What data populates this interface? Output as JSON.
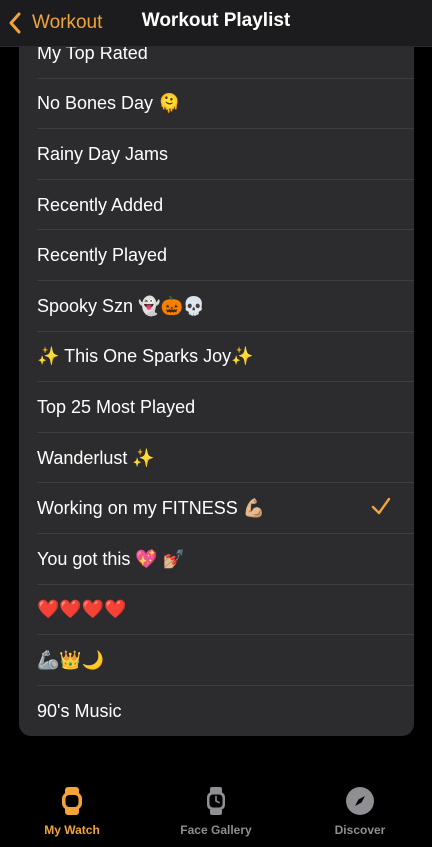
{
  "nav": {
    "back_label": "Workout",
    "title": "Workout Playlist"
  },
  "playlists": [
    {
      "label": "My Top Rated",
      "selected": false
    },
    {
      "label": "No Bones Day 🫠",
      "selected": false
    },
    {
      "label": "Rainy Day Jams",
      "selected": false
    },
    {
      "label": "Recently Added",
      "selected": false
    },
    {
      "label": "Recently Played",
      "selected": false
    },
    {
      "label": "Spooky Szn 👻🎃💀",
      "selected": false
    },
    {
      "label": "✨ This One Sparks Joy✨",
      "selected": false
    },
    {
      "label": "Top 25 Most Played",
      "selected": false
    },
    {
      "label": "Wanderlust ✨",
      "selected": false
    },
    {
      "label": "Working on my FITNESS 💪🏼",
      "selected": true
    },
    {
      "label": "You got this 💖 💅🏼",
      "selected": false
    },
    {
      "label": "❤️❤️❤️❤️",
      "selected": false
    },
    {
      "label": "🦾👑🌙",
      "selected": false
    },
    {
      "label": "90's Music",
      "selected": false
    }
  ],
  "tabs": [
    {
      "label": "My Watch",
      "icon": "watch-icon",
      "active": true
    },
    {
      "label": "Face Gallery",
      "icon": "watch-face-icon",
      "active": false
    },
    {
      "label": "Discover",
      "icon": "compass-icon",
      "active": false
    }
  ],
  "colors": {
    "accent": "#f2a33a",
    "inactive": "#8e8e93",
    "background": "#000000",
    "card": "#2c2c2e"
  }
}
